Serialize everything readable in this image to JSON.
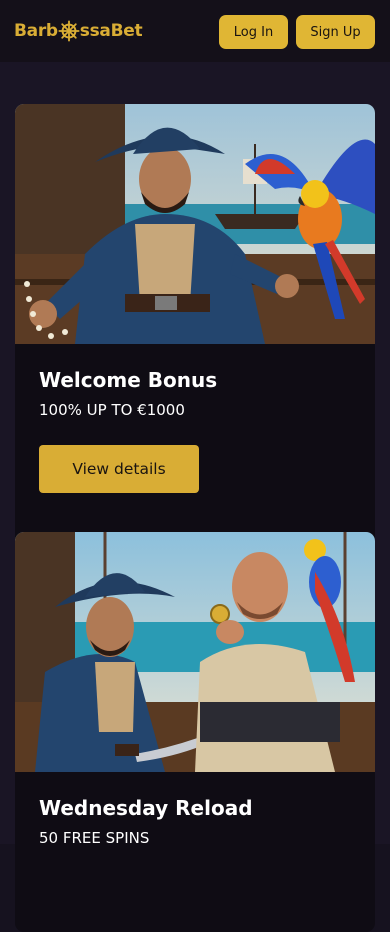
{
  "header": {
    "logo_prefix": "Barb",
    "logo_suffix": "ssaBet",
    "login_label": "Log In",
    "signup_label": "Sign Up"
  },
  "promotions": [
    {
      "title": "Welcome Bonus",
      "subtitle": "100% UP TO €1000",
      "button_label": "View details",
      "image": "pirate-captain-with-parrot-illustration"
    },
    {
      "title": "Wednesday Reload",
      "subtitle": "50 FREE SPINS",
      "image": "pirates-with-gold-coin-illustration"
    }
  ],
  "colors": {
    "accent": "#e0b634",
    "background": "#16121f",
    "card": "#0f0c14"
  }
}
